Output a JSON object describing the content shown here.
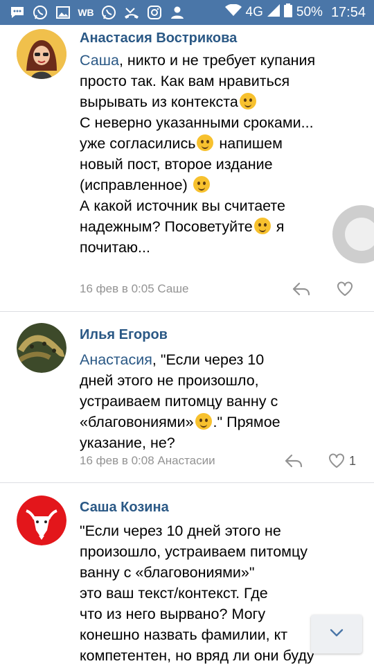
{
  "statusbar": {
    "left_icons": [
      "messages-icon",
      "whatsapp-icon",
      "gallery-icon",
      "wb-icon",
      "whatsapp-icon",
      "missed-call-icon",
      "instagram-icon",
      "user-icon"
    ],
    "wb_label": "WB",
    "network": "4G",
    "battery": "50%",
    "time": "17:54"
  },
  "comments": [
    {
      "author": "Анастасия Вострикова",
      "lines": [
        {
          "mention": "Саша",
          "text": ", никто и не требует купания"
        },
        {
          "text": "просто так. Как вам нравиться"
        },
        {
          "text": "вырывать из контекста",
          "emoji": "grinning-sweat-emoji"
        },
        {
          "text": "С неверно указанными сроками..."
        },
        {
          "text": "уже согласились",
          "emoji": "thinking-face-emoji",
          "after": " напишем"
        },
        {
          "text": "новый пост, второе издание"
        },
        {
          "text": "(исправленное) ",
          "emoji": "smiling-face-emoji"
        },
        {
          "text": "А какой источник вы считаете"
        },
        {
          "text": "надежным? Посоветуйте",
          "emoji": "winking-face-emoji",
          "after": " я"
        },
        {
          "text": "почитаю..."
        }
      ],
      "meta": "16 фев в 0:05 Саше",
      "likes": ""
    },
    {
      "author": "Илья Егоров",
      "lines": [
        {
          "mention": "Анастасия",
          "text": ", \"Если через 10"
        },
        {
          "text": "дней этого не произошло,"
        },
        {
          "text": "устраиваем питомцу ванну с"
        },
        {
          "text": "«благовониями»",
          "emoji": "winking-face-emoji",
          "after": ".\" Прямое"
        },
        {
          "text": "указание, не?"
        }
      ],
      "meta": "16 фев в 0:08 Анастасии",
      "likes": "1"
    },
    {
      "author": "Саша Козина",
      "lines": [
        {
          "text": "\"Если через 10 дней этого не"
        },
        {
          "text": "произошло, устраиваем питомцу"
        },
        {
          "text": "ванну с «благовониями»\""
        },
        {
          "text": "это ваш текст/контекст. Где"
        },
        {
          "text": "что из него вырвано? Могу"
        },
        {
          "text": "конешно назвать фамилии, кт"
        },
        {
          "text": "компетентен, но вряд ли они буду"
        }
      ]
    }
  ],
  "colors": {
    "statusbar": "#4a76a8",
    "author": "#2a5885",
    "meta": "#939393"
  }
}
